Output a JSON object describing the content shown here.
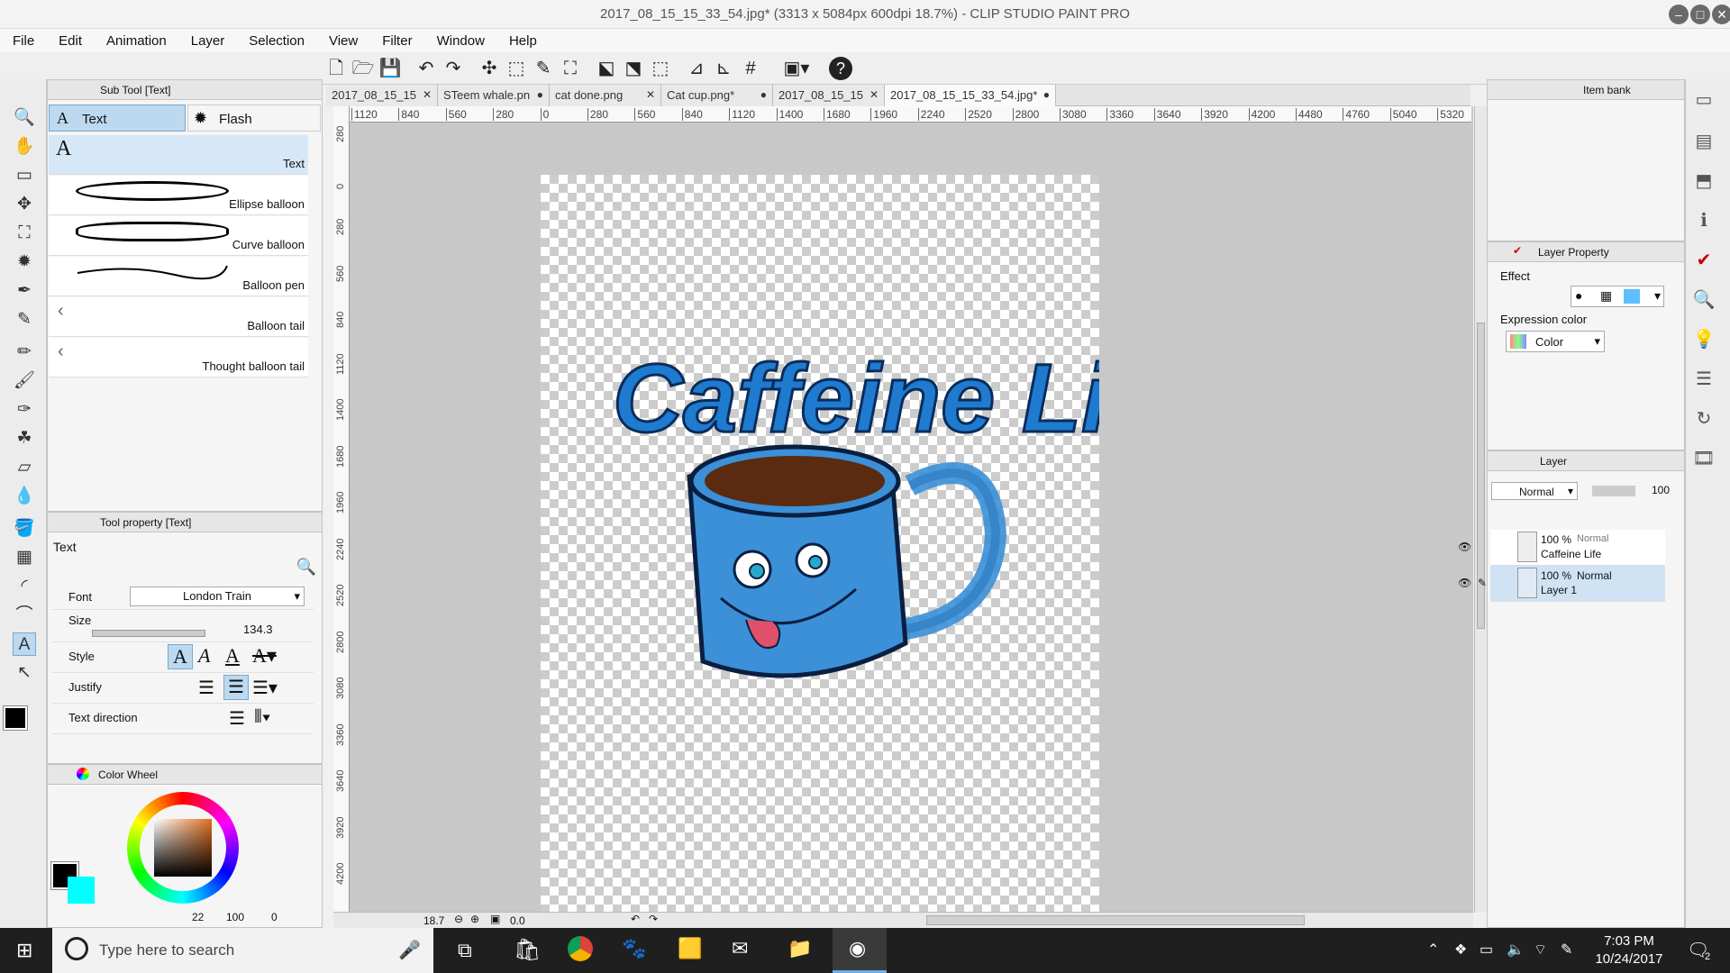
{
  "window": {
    "title": "2017_08_15_15_33_54.jpg* (3313 x 5084px 600dpi 18.7%) - CLIP STUDIO PAINT PRO"
  },
  "menu": [
    "File",
    "Edit",
    "Animation",
    "Layer",
    "Selection",
    "View",
    "Filter",
    "Window",
    "Help"
  ],
  "subtool": {
    "panel_title": "Sub Tool [Text]",
    "tab_text": "Text",
    "tab_flash": "Flash",
    "items": [
      "Text",
      "Ellipse balloon",
      "Curve balloon",
      "Balloon pen",
      "Balloon tail",
      "Thought balloon tail"
    ]
  },
  "toolprop": {
    "panel_title": "Tool property [Text]",
    "name": "Text",
    "font_label": "Font",
    "font_value": "London Train",
    "size_label": "Size",
    "size_value": "134.3",
    "style_label": "Style",
    "justify_label": "Justify",
    "direction_label": "Text direction"
  },
  "colorwheel": {
    "panel_title": "Color Wheel",
    "v1": "22",
    "v2": "100",
    "v3": "0"
  },
  "tabs": [
    {
      "label": "2017_08_15_15"
    },
    {
      "label": "STeem whale.pn"
    },
    {
      "label": "cat done.png"
    },
    {
      "label": "Cat cup.png*"
    },
    {
      "label": "2017_08_15_15"
    },
    {
      "label": "2017_08_15_15_33_54.jpg*"
    }
  ],
  "ruler_h": [
    "1120",
    "840",
    "560",
    "280",
    "0",
    "280",
    "560",
    "840",
    "1120",
    "1400",
    "1680",
    "1960",
    "2240",
    "2520",
    "2800",
    "3080",
    "3360",
    "3640",
    "3920",
    "4200",
    "4480",
    "4760",
    "5040",
    "5320"
  ],
  "ruler_v": [
    "280",
    "0",
    "280",
    "560",
    "840",
    "1120",
    "1400",
    "1680",
    "1960",
    "2240",
    "2520",
    "2800",
    "3080",
    "3360",
    "3640",
    "3920",
    "4200"
  ],
  "status": {
    "zoom": "18.7",
    "angle": "0.0"
  },
  "right": {
    "itembank": "Item bank",
    "layerprop": "Layer Property",
    "effect": "Effect",
    "expr_color": "Expression color",
    "expr_value": "Color",
    "layer_tab": "Layer",
    "blend": "Normal",
    "opacity": "100",
    "layers": [
      {
        "pct": "100 %",
        "mode": "Normal",
        "name": "Caffeine Life"
      },
      {
        "pct": "100 %",
        "mode": "Normal",
        "name": "Layer 1"
      }
    ]
  },
  "artwork": {
    "title_text": "Caffeine Life"
  },
  "taskbar": {
    "search": "Type here to search",
    "time": "7:03 PM",
    "date": "10/24/2017",
    "notif": "2"
  },
  "colors": {
    "accent": "#1e7bd0",
    "mug": "#3b90d8",
    "coffee": "#5a2b10"
  }
}
